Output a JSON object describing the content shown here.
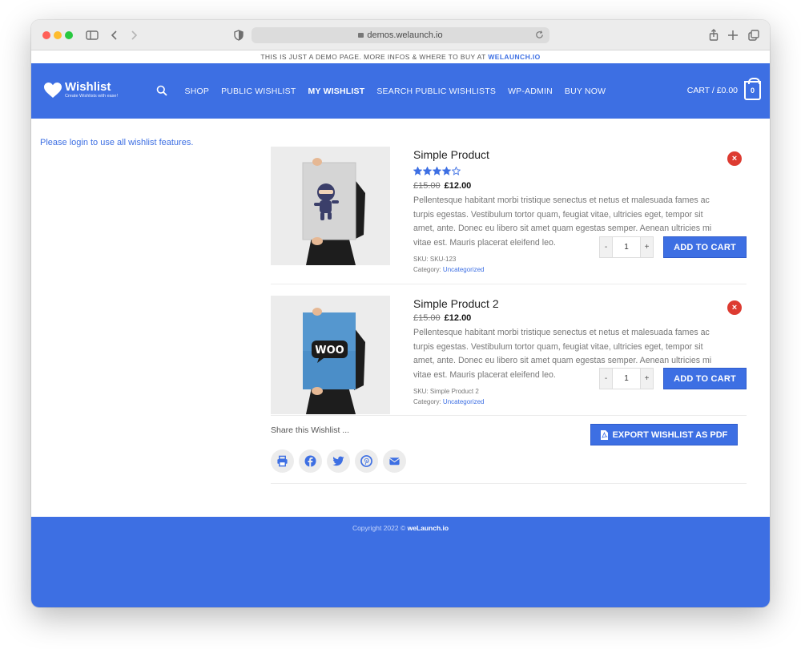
{
  "browser": {
    "url": "demos.welaunch.io"
  },
  "notice": {
    "text": "THIS IS JUST A DEMO PAGE. MORE INFOS & WHERE TO BUY AT ",
    "link": "WELAUNCH.IO"
  },
  "header": {
    "logo_title": "Wishlist",
    "logo_tagline": "Create Wishlists with ease!",
    "nav": [
      "SHOP",
      "PUBLIC WISHLIST",
      "MY WISHLIST",
      "SEARCH PUBLIC WISHLISTS",
      "WP-ADMIN",
      "BUY NOW"
    ],
    "active_nav": "MY WISHLIST",
    "cart_label": "CART / £0.00",
    "cart_count": "0"
  },
  "login_message": "Please login to use all wishlist features.",
  "products": [
    {
      "title": "Simple Product",
      "rating": 4,
      "rating_max": 5,
      "old_price": "£15.00",
      "price": "£12.00",
      "description": "Pellentesque habitant morbi tristique senectus et netus et malesuada fames ac turpis egestas. Vestibulum tortor quam, feugiat vitae, ultricies eget, tempor sit amet, ante. Donec eu libero sit amet quam egestas semper. Aenean ultricies mi vitae est. Mauris placerat eleifend leo.",
      "sku": "SKU: SKU-123",
      "category_label": "Category:",
      "category": "Uncategorized",
      "qty_minus": "-",
      "qty": "1",
      "qty_plus": "+",
      "add_to_cart": "ADD TO CART",
      "remove": "×"
    },
    {
      "title": "Simple Product 2",
      "old_price": "£15.00",
      "price": "£12.00",
      "description": "Pellentesque habitant morbi tristique senectus et netus et malesuada fames ac turpis egestas. Vestibulum tortor quam, feugiat vitae, ultricies eget, tempor sit amet, ante. Donec eu libero sit amet quam egestas semper. Aenean ultricies mi vitae est. Mauris placerat eleifend leo.",
      "sku": "SKU: Simple Product 2",
      "category_label": "Category:",
      "category": "Uncategorized",
      "qty_minus": "-",
      "qty": "1",
      "qty_plus": "+",
      "add_to_cart": "ADD TO CART",
      "remove": "×",
      "poster_text": "WOO"
    }
  ],
  "share": {
    "label": "Share this Wishlist ...",
    "export_label": "EXPORT WISHLIST AS PDF",
    "icons": [
      "print-icon",
      "facebook-icon",
      "twitter-icon",
      "pinterest-icon",
      "email-icon"
    ]
  },
  "footer": {
    "copyright_prefix": "Copyright 2022 © ",
    "copyright_brand": "weLaunch.io"
  },
  "colors": {
    "brand": "#3d6fe3",
    "remove": "#dd3b31"
  }
}
